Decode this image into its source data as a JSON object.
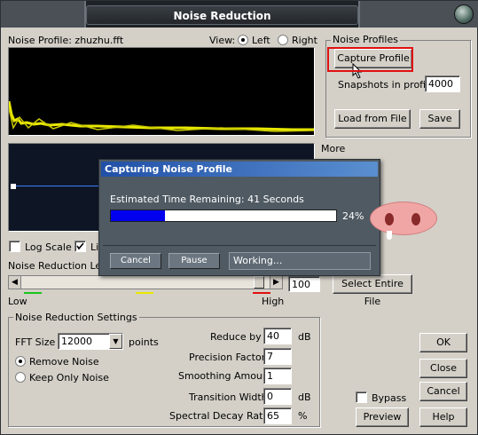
{
  "window": {
    "title": "Noise Reduction"
  },
  "profile": {
    "label": "Noise Profile: zhuzhu.fft",
    "view_label": "View:",
    "view_left": "Left",
    "view_right": "Right"
  },
  "noise_profiles": {
    "group_label": "Noise Profiles",
    "capture_button": "Capture Profile",
    "snapshots_label": "Snapshots in profile",
    "snapshots_value": "4000",
    "load_button": "Load from File",
    "save_button": "Save"
  },
  "curve": {
    "more_label": "More",
    "log_scale_label": "Log Scale",
    "linear_label": "Li",
    "level_label": "Noise Reduction Lev",
    "slider_low": "Low",
    "slider_high": "High",
    "level_value": "100",
    "select_entire_button": "Select Entire File"
  },
  "settings": {
    "group_label": "Noise Reduction Settings",
    "fft_size_label": "FFT Size",
    "fft_size_value": "12000",
    "points_label": "points",
    "remove_noise": "Remove Noise",
    "keep_only_noise": "Keep Only Noise",
    "reduce_by_label": "Reduce by",
    "reduce_by_value": "40",
    "reduce_by_unit": "dB",
    "precision_label": "Precision Factor",
    "precision_value": "7",
    "smoothing_label": "Smoothing Amount",
    "smoothing_value": "1",
    "transition_label": "Transition Width",
    "transition_value": "0",
    "transition_unit": "dB",
    "decay_label": "Spectral Decay Rate",
    "decay_value": "65",
    "decay_unit": "%"
  },
  "actions": {
    "ok": "OK",
    "close": "Close",
    "cancel": "Cancel",
    "bypass": "Bypass",
    "preview": "Preview",
    "help": "Help"
  },
  "capture_dialog": {
    "title": "Capturing Noise Profile",
    "estimate": "Estimated Time Remaining: 41 Seconds",
    "progress_percent": 24,
    "progress_label": "24%",
    "cancel_button": "Cancel",
    "pause_button": "Pause",
    "status": "Working..."
  },
  "colors": {
    "dialog_title": "#2150a8",
    "progress_fill": "#0000ee",
    "highlight": "#e01010",
    "spectrum": "#e8e800"
  }
}
